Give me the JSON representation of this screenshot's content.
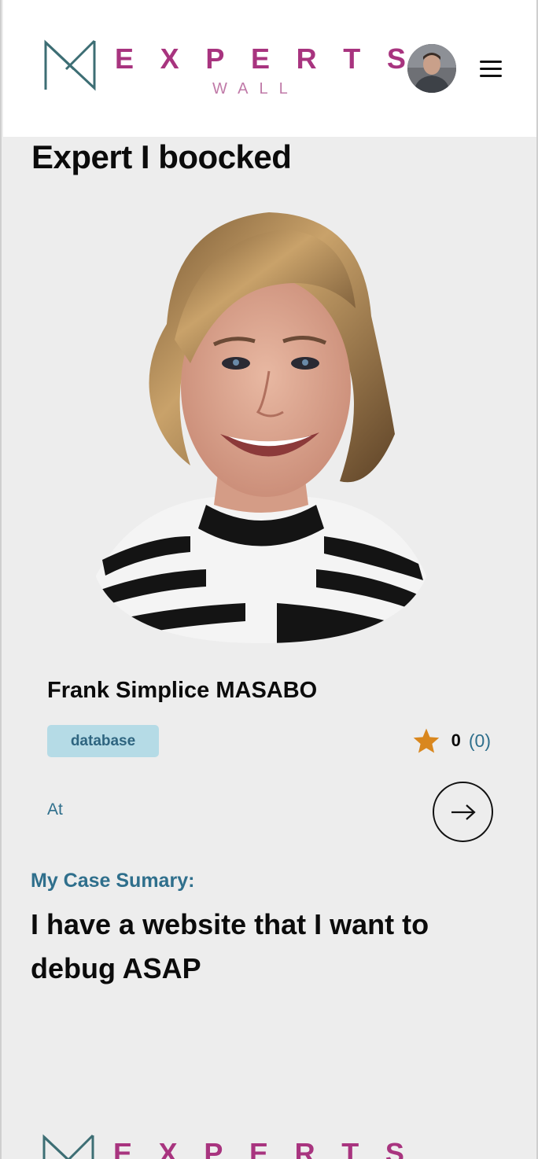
{
  "header": {
    "logo": {
      "word": "EXPERTS",
      "letters": [
        "E",
        "X",
        "P",
        "E",
        "R",
        "T",
        "S"
      ],
      "sub": "WALL"
    },
    "avatar_icon": "user-avatar",
    "menu_icon": "hamburger-menu-icon"
  },
  "page": {
    "title": "Expert I boocked"
  },
  "expert": {
    "name": "Frank Simplice MASABO",
    "tag": "database",
    "rating_icon": "star-icon",
    "rating": "0",
    "reviews": "(0)",
    "at_label": "At",
    "go_icon": "arrow-right-icon"
  },
  "summary": {
    "label": "My Case Sumary:",
    "text": "I have a website that I want to debug ASAP"
  },
  "colors": {
    "brand": "#a8347f",
    "accent_text": "#2f6f8c",
    "tag_bg": "#b5dbe6",
    "star": "#d9871e",
    "page_bg": "#ededed"
  }
}
